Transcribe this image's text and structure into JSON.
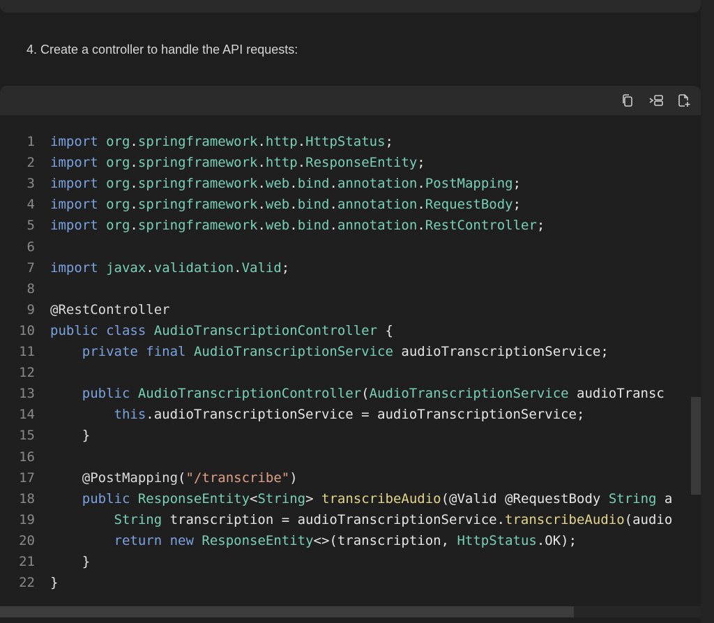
{
  "step": {
    "text": "4. Create a controller to handle the API requests:"
  },
  "toolbar": {
    "buttons": [
      {
        "name": "copy-icon"
      },
      {
        "name": "insert-icon"
      },
      {
        "name": "new-file-icon"
      }
    ]
  },
  "code": {
    "language": "java",
    "lines": [
      {
        "n": "1",
        "tokens": [
          [
            "kw",
            "import"
          ],
          [
            "pl",
            " "
          ],
          [
            "ty",
            "org"
          ],
          [
            "pl",
            "."
          ],
          [
            "ty",
            "springframework"
          ],
          [
            "pl",
            "."
          ],
          [
            "ty",
            "http"
          ],
          [
            "pl",
            "."
          ],
          [
            "ty",
            "HttpStatus"
          ],
          [
            "pl",
            ";"
          ]
        ]
      },
      {
        "n": "2",
        "tokens": [
          [
            "kw",
            "import"
          ],
          [
            "pl",
            " "
          ],
          [
            "ty",
            "org"
          ],
          [
            "pl",
            "."
          ],
          [
            "ty",
            "springframework"
          ],
          [
            "pl",
            "."
          ],
          [
            "ty",
            "http"
          ],
          [
            "pl",
            "."
          ],
          [
            "ty",
            "ResponseEntity"
          ],
          [
            "pl",
            ";"
          ]
        ]
      },
      {
        "n": "3",
        "tokens": [
          [
            "kw",
            "import"
          ],
          [
            "pl",
            " "
          ],
          [
            "ty",
            "org"
          ],
          [
            "pl",
            "."
          ],
          [
            "ty",
            "springframework"
          ],
          [
            "pl",
            "."
          ],
          [
            "ty",
            "web"
          ],
          [
            "pl",
            "."
          ],
          [
            "ty",
            "bind"
          ],
          [
            "pl",
            "."
          ],
          [
            "ty",
            "annotation"
          ],
          [
            "pl",
            "."
          ],
          [
            "ty",
            "PostMapping"
          ],
          [
            "pl",
            ";"
          ]
        ]
      },
      {
        "n": "4",
        "tokens": [
          [
            "kw",
            "import"
          ],
          [
            "pl",
            " "
          ],
          [
            "ty",
            "org"
          ],
          [
            "pl",
            "."
          ],
          [
            "ty",
            "springframework"
          ],
          [
            "pl",
            "."
          ],
          [
            "ty",
            "web"
          ],
          [
            "pl",
            "."
          ],
          [
            "ty",
            "bind"
          ],
          [
            "pl",
            "."
          ],
          [
            "ty",
            "annotation"
          ],
          [
            "pl",
            "."
          ],
          [
            "ty",
            "RequestBody"
          ],
          [
            "pl",
            ";"
          ]
        ]
      },
      {
        "n": "5",
        "tokens": [
          [
            "kw",
            "import"
          ],
          [
            "pl",
            " "
          ],
          [
            "ty",
            "org"
          ],
          [
            "pl",
            "."
          ],
          [
            "ty",
            "springframework"
          ],
          [
            "pl",
            "."
          ],
          [
            "ty",
            "web"
          ],
          [
            "pl",
            "."
          ],
          [
            "ty",
            "bind"
          ],
          [
            "pl",
            "."
          ],
          [
            "ty",
            "annotation"
          ],
          [
            "pl",
            "."
          ],
          [
            "ty",
            "RestController"
          ],
          [
            "pl",
            ";"
          ]
        ]
      },
      {
        "n": "6",
        "tokens": []
      },
      {
        "n": "7",
        "tokens": [
          [
            "kw",
            "import"
          ],
          [
            "pl",
            " "
          ],
          [
            "ty",
            "javax"
          ],
          [
            "pl",
            "."
          ],
          [
            "ty",
            "validation"
          ],
          [
            "pl",
            "."
          ],
          [
            "ty",
            "Valid"
          ],
          [
            "pl",
            ";"
          ]
        ]
      },
      {
        "n": "8",
        "tokens": []
      },
      {
        "n": "9",
        "tokens": [
          [
            "an",
            "@RestController"
          ]
        ]
      },
      {
        "n": "10",
        "tokens": [
          [
            "kw",
            "public"
          ],
          [
            "pl",
            " "
          ],
          [
            "kw",
            "class"
          ],
          [
            "pl",
            " "
          ],
          [
            "ty",
            "AudioTranscriptionController"
          ],
          [
            "pl",
            " {"
          ]
        ]
      },
      {
        "n": "11",
        "tokens": [
          [
            "pl",
            "    "
          ],
          [
            "kw",
            "private"
          ],
          [
            "pl",
            " "
          ],
          [
            "kw",
            "final"
          ],
          [
            "pl",
            " "
          ],
          [
            "ty",
            "AudioTranscriptionService"
          ],
          [
            "pl",
            " audioTranscriptionService;"
          ]
        ]
      },
      {
        "n": "12",
        "tokens": []
      },
      {
        "n": "13",
        "tokens": [
          [
            "pl",
            "    "
          ],
          [
            "kw",
            "public"
          ],
          [
            "pl",
            " "
          ],
          [
            "ty",
            "AudioTranscriptionController"
          ],
          [
            "pl",
            "("
          ],
          [
            "ty",
            "AudioTranscriptionService"
          ],
          [
            "pl",
            " audioTransc"
          ]
        ]
      },
      {
        "n": "14",
        "tokens": [
          [
            "pl",
            "        "
          ],
          [
            "kw",
            "this"
          ],
          [
            "pl",
            ".audioTranscriptionService = audioTranscriptionService;"
          ]
        ]
      },
      {
        "n": "15",
        "tokens": [
          [
            "pl",
            "    }"
          ]
        ]
      },
      {
        "n": "16",
        "tokens": []
      },
      {
        "n": "17",
        "tokens": [
          [
            "pl",
            "    "
          ],
          [
            "an",
            "@PostMapping"
          ],
          [
            "pl",
            "("
          ],
          [
            "str",
            "\"/transcribe\""
          ],
          [
            "pl",
            ")"
          ]
        ]
      },
      {
        "n": "18",
        "tokens": [
          [
            "pl",
            "    "
          ],
          [
            "kw",
            "public"
          ],
          [
            "pl",
            " "
          ],
          [
            "ty",
            "ResponseEntity"
          ],
          [
            "pl",
            "<"
          ],
          [
            "ty",
            "String"
          ],
          [
            "pl",
            "> "
          ],
          [
            "fn",
            "transcribeAudio"
          ],
          [
            "pl",
            "(@Valid @RequestBody "
          ],
          [
            "ty",
            "String"
          ],
          [
            "pl",
            " a"
          ]
        ]
      },
      {
        "n": "19",
        "tokens": [
          [
            "pl",
            "        "
          ],
          [
            "ty",
            "String"
          ],
          [
            "pl",
            " transcription = audioTranscriptionService."
          ],
          [
            "fn",
            "transcribeAudio"
          ],
          [
            "pl",
            "(audio"
          ]
        ]
      },
      {
        "n": "20",
        "tokens": [
          [
            "pl",
            "        "
          ],
          [
            "kw",
            "return"
          ],
          [
            "pl",
            " "
          ],
          [
            "kw",
            "new"
          ],
          [
            "pl",
            " "
          ],
          [
            "ty",
            "ResponseEntity"
          ],
          [
            "pl",
            "<>(transcription, "
          ],
          [
            "ty",
            "HttpStatus"
          ],
          [
            "pl",
            ".OK);"
          ]
        ]
      },
      {
        "n": "21",
        "tokens": [
          [
            "pl",
            "    }"
          ]
        ]
      },
      {
        "n": "22",
        "tokens": [
          [
            "pl",
            "}"
          ]
        ]
      }
    ]
  },
  "colors": {
    "background": "#1e1e1e",
    "keyword": "#7aa3e0",
    "type": "#78d0b8",
    "function": "#e4d58b",
    "string": "#e0a088",
    "plain": "#e6e6e6",
    "line_number": "#8a8a8a"
  }
}
